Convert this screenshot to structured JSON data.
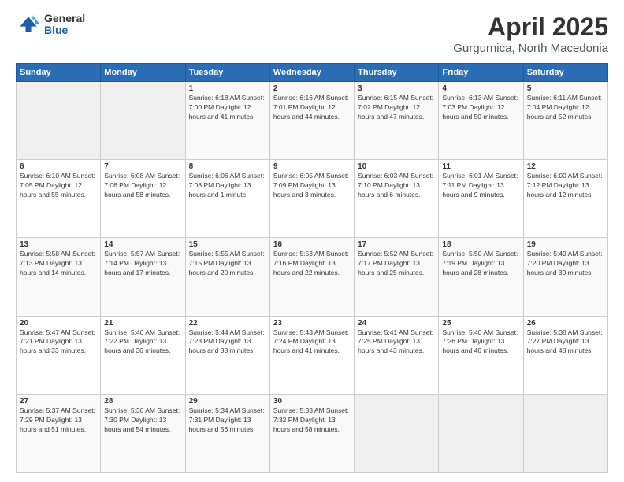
{
  "logo": {
    "general": "General",
    "blue": "Blue"
  },
  "header": {
    "title": "April 2025",
    "subtitle": "Gurgurnica, North Macedonia"
  },
  "weekdays": [
    "Sunday",
    "Monday",
    "Tuesday",
    "Wednesday",
    "Thursday",
    "Friday",
    "Saturday"
  ],
  "weeks": [
    [
      {
        "day": "",
        "info": ""
      },
      {
        "day": "",
        "info": ""
      },
      {
        "day": "1",
        "info": "Sunrise: 6:18 AM\nSunset: 7:00 PM\nDaylight: 12 hours and 41 minutes."
      },
      {
        "day": "2",
        "info": "Sunrise: 6:16 AM\nSunset: 7:01 PM\nDaylight: 12 hours and 44 minutes."
      },
      {
        "day": "3",
        "info": "Sunrise: 6:15 AM\nSunset: 7:02 PM\nDaylight: 12 hours and 47 minutes."
      },
      {
        "day": "4",
        "info": "Sunrise: 6:13 AM\nSunset: 7:03 PM\nDaylight: 12 hours and 50 minutes."
      },
      {
        "day": "5",
        "info": "Sunrise: 6:11 AM\nSunset: 7:04 PM\nDaylight: 12 hours and 52 minutes."
      }
    ],
    [
      {
        "day": "6",
        "info": "Sunrise: 6:10 AM\nSunset: 7:05 PM\nDaylight: 12 hours and 55 minutes."
      },
      {
        "day": "7",
        "info": "Sunrise: 6:08 AM\nSunset: 7:06 PM\nDaylight: 12 hours and 58 minutes."
      },
      {
        "day": "8",
        "info": "Sunrise: 6:06 AM\nSunset: 7:08 PM\nDaylight: 13 hours and 1 minute."
      },
      {
        "day": "9",
        "info": "Sunrise: 6:05 AM\nSunset: 7:09 PM\nDaylight: 13 hours and 3 minutes."
      },
      {
        "day": "10",
        "info": "Sunrise: 6:03 AM\nSunset: 7:10 PM\nDaylight: 13 hours and 6 minutes."
      },
      {
        "day": "11",
        "info": "Sunrise: 6:01 AM\nSunset: 7:11 PM\nDaylight: 13 hours and 9 minutes."
      },
      {
        "day": "12",
        "info": "Sunrise: 6:00 AM\nSunset: 7:12 PM\nDaylight: 13 hours and 12 minutes."
      }
    ],
    [
      {
        "day": "13",
        "info": "Sunrise: 5:58 AM\nSunset: 7:13 PM\nDaylight: 13 hours and 14 minutes."
      },
      {
        "day": "14",
        "info": "Sunrise: 5:57 AM\nSunset: 7:14 PM\nDaylight: 13 hours and 17 minutes."
      },
      {
        "day": "15",
        "info": "Sunrise: 5:55 AM\nSunset: 7:15 PM\nDaylight: 13 hours and 20 minutes."
      },
      {
        "day": "16",
        "info": "Sunrise: 5:53 AM\nSunset: 7:16 PM\nDaylight: 13 hours and 22 minutes."
      },
      {
        "day": "17",
        "info": "Sunrise: 5:52 AM\nSunset: 7:17 PM\nDaylight: 13 hours and 25 minutes."
      },
      {
        "day": "18",
        "info": "Sunrise: 5:50 AM\nSunset: 7:19 PM\nDaylight: 13 hours and 28 minutes."
      },
      {
        "day": "19",
        "info": "Sunrise: 5:49 AM\nSunset: 7:20 PM\nDaylight: 13 hours and 30 minutes."
      }
    ],
    [
      {
        "day": "20",
        "info": "Sunrise: 5:47 AM\nSunset: 7:21 PM\nDaylight: 13 hours and 33 minutes."
      },
      {
        "day": "21",
        "info": "Sunrise: 5:46 AM\nSunset: 7:22 PM\nDaylight: 13 hours and 36 minutes."
      },
      {
        "day": "22",
        "info": "Sunrise: 5:44 AM\nSunset: 7:23 PM\nDaylight: 13 hours and 38 minutes."
      },
      {
        "day": "23",
        "info": "Sunrise: 5:43 AM\nSunset: 7:24 PM\nDaylight: 13 hours and 41 minutes."
      },
      {
        "day": "24",
        "info": "Sunrise: 5:41 AM\nSunset: 7:25 PM\nDaylight: 13 hours and 43 minutes."
      },
      {
        "day": "25",
        "info": "Sunrise: 5:40 AM\nSunset: 7:26 PM\nDaylight: 13 hours and 46 minutes."
      },
      {
        "day": "26",
        "info": "Sunrise: 5:38 AM\nSunset: 7:27 PM\nDaylight: 13 hours and 48 minutes."
      }
    ],
    [
      {
        "day": "27",
        "info": "Sunrise: 5:37 AM\nSunset: 7:29 PM\nDaylight: 13 hours and 51 minutes."
      },
      {
        "day": "28",
        "info": "Sunrise: 5:36 AM\nSunset: 7:30 PM\nDaylight: 13 hours and 54 minutes."
      },
      {
        "day": "29",
        "info": "Sunrise: 5:34 AM\nSunset: 7:31 PM\nDaylight: 13 hours and 56 minutes."
      },
      {
        "day": "30",
        "info": "Sunrise: 5:33 AM\nSunset: 7:32 PM\nDaylight: 13 hours and 58 minutes."
      },
      {
        "day": "",
        "info": ""
      },
      {
        "day": "",
        "info": ""
      },
      {
        "day": "",
        "info": ""
      }
    ]
  ]
}
